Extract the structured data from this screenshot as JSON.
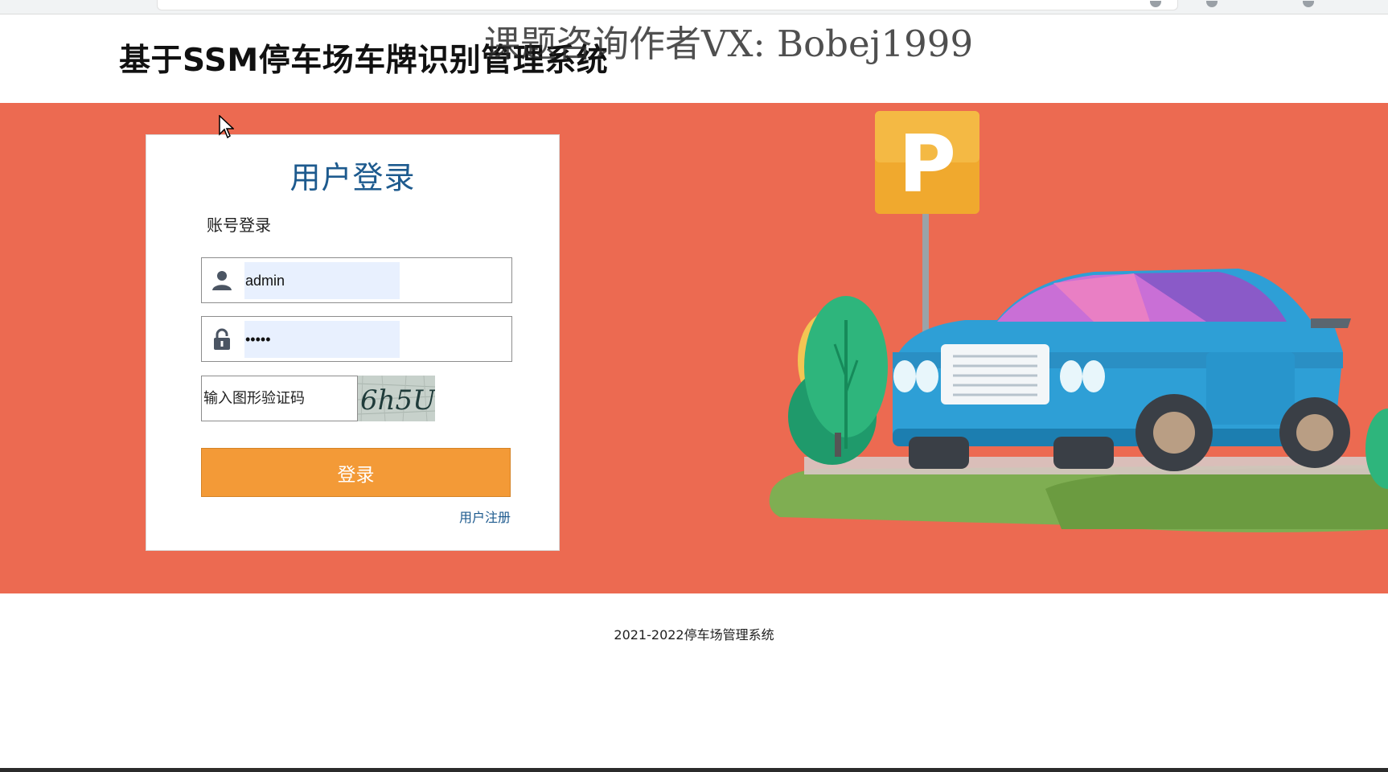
{
  "header": {
    "site_title": "基于SSM停车场车牌识别管理系统",
    "watermark": "课题咨询作者VX: Bobej1999"
  },
  "login": {
    "title": "用户登录",
    "subtitle": "账号登录",
    "username": {
      "value": "admin",
      "icon": "user-icon"
    },
    "password": {
      "value": "•••••",
      "icon": "lock-icon"
    },
    "captcha": {
      "placeholder": "输入图形验证码",
      "image_text": "6h5U"
    },
    "submit_label": "登录",
    "register_label": "用户注册"
  },
  "illustration": {
    "sign_letter": "P"
  },
  "footer": {
    "text": "2021-2022停车场管理系统"
  },
  "colors": {
    "banner": "#ec6a51",
    "button": "#f39a37",
    "title_blue": "#1d5a8e",
    "input_autofill": "#e8f0fe"
  }
}
